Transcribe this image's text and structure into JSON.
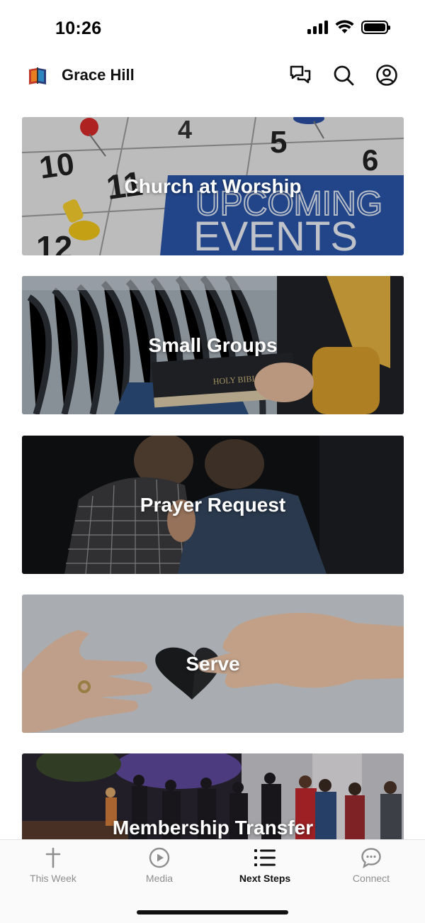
{
  "status_bar": {
    "time": "10:26"
  },
  "header": {
    "title": "Grace Hill"
  },
  "icons": {
    "logo": "book-logo",
    "messages": "chat-bubbles-icon",
    "search": "search-icon",
    "profile": "account-icon"
  },
  "cards": [
    {
      "title": "Church at Worship",
      "image_text_top": "UPCOMING",
      "image_text_bottom": "EVENTS",
      "calendar_numbers": [
        "10",
        "11",
        "4",
        "5",
        "6",
        "12"
      ]
    },
    {
      "title": "Small Groups",
      "image_text": "HOLY BIBLE"
    },
    {
      "title": "Prayer Request"
    },
    {
      "title": "Serve"
    },
    {
      "title": "Membership Transfer"
    }
  ],
  "tabs": [
    {
      "label": "This Week",
      "icon": "cross-icon",
      "active": false
    },
    {
      "label": "Media",
      "icon": "play-icon",
      "active": false
    },
    {
      "label": "Next Steps",
      "icon": "list-icon",
      "active": true
    },
    {
      "label": "Connect",
      "icon": "chat-icon",
      "active": false
    }
  ],
  "colors": {
    "accent": "#111111",
    "inactive": "#8e8e8e",
    "events_blue": "#2a55a8"
  }
}
